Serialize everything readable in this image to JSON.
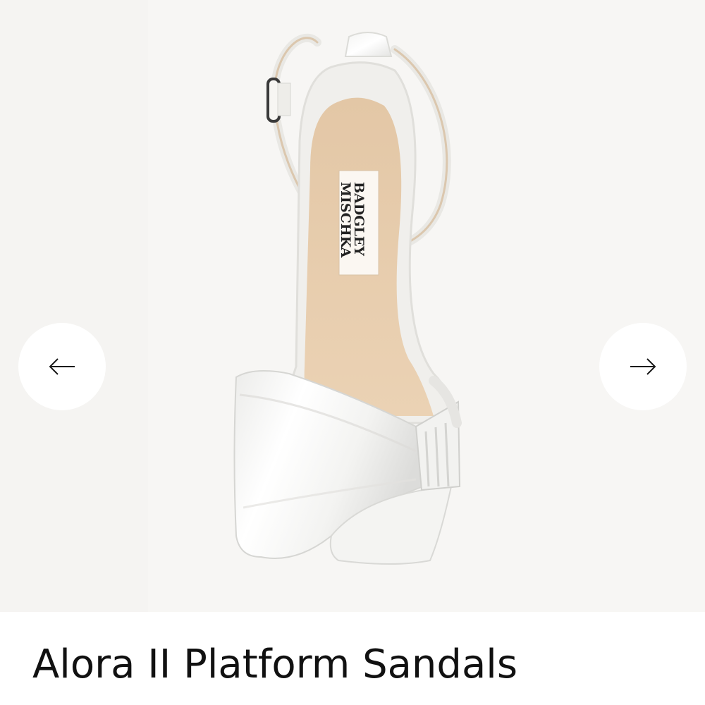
{
  "gallery": {
    "background_color": "#f7f6f4",
    "image": {
      "subject": "white satin ankle-strap sandal with oversized bow, top view",
      "brand_label": "BADGLEY MISCHKA"
    },
    "prev_button": {
      "icon": "arrow-left-icon"
    },
    "next_button": {
      "icon": "arrow-right-icon"
    }
  },
  "product": {
    "title": "Alora II Platform Sandals"
  }
}
